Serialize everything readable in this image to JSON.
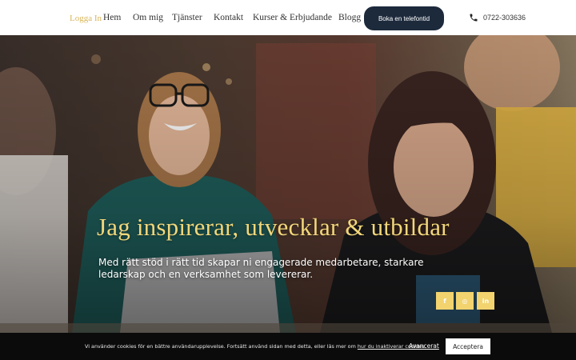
{
  "nav": {
    "login": "Logga In",
    "links": [
      "Hem",
      "Om mig",
      "Tjänster",
      "Kontakt",
      "Kurser & Erbjudande",
      "Blogg"
    ],
    "book_button": "Boka en telefontid",
    "phone": "0722-303636"
  },
  "hero": {
    "heading": "Jag inspirerar, utvecklar & utbildar",
    "subtext": "Med rätt stöd i rätt tid skapar ni engagerade medarbetare, starkare ledarskap och en verksamhet som levererar."
  },
  "social": [
    {
      "icon": "facebook-icon",
      "glyph": "f"
    },
    {
      "icon": "instagram-icon",
      "glyph": "◎"
    },
    {
      "icon": "linkedin-icon",
      "glyph": "in"
    }
  ],
  "cookie": {
    "text_before": "Vi använder cookies för en bättre användarupplevelse. Fortsätt använd sidan med detta, eller läs mer om ",
    "link": "hur du inaktiverar cookies",
    "text_after": ".",
    "more": "Avancerat",
    "accept": "Acceptera"
  },
  "colors": {
    "accent_gold": "#f2d36e",
    "login_gold": "#d9b65a",
    "button_navy": "#1d2a3c",
    "cookie_bg": "#0b0b0b"
  }
}
